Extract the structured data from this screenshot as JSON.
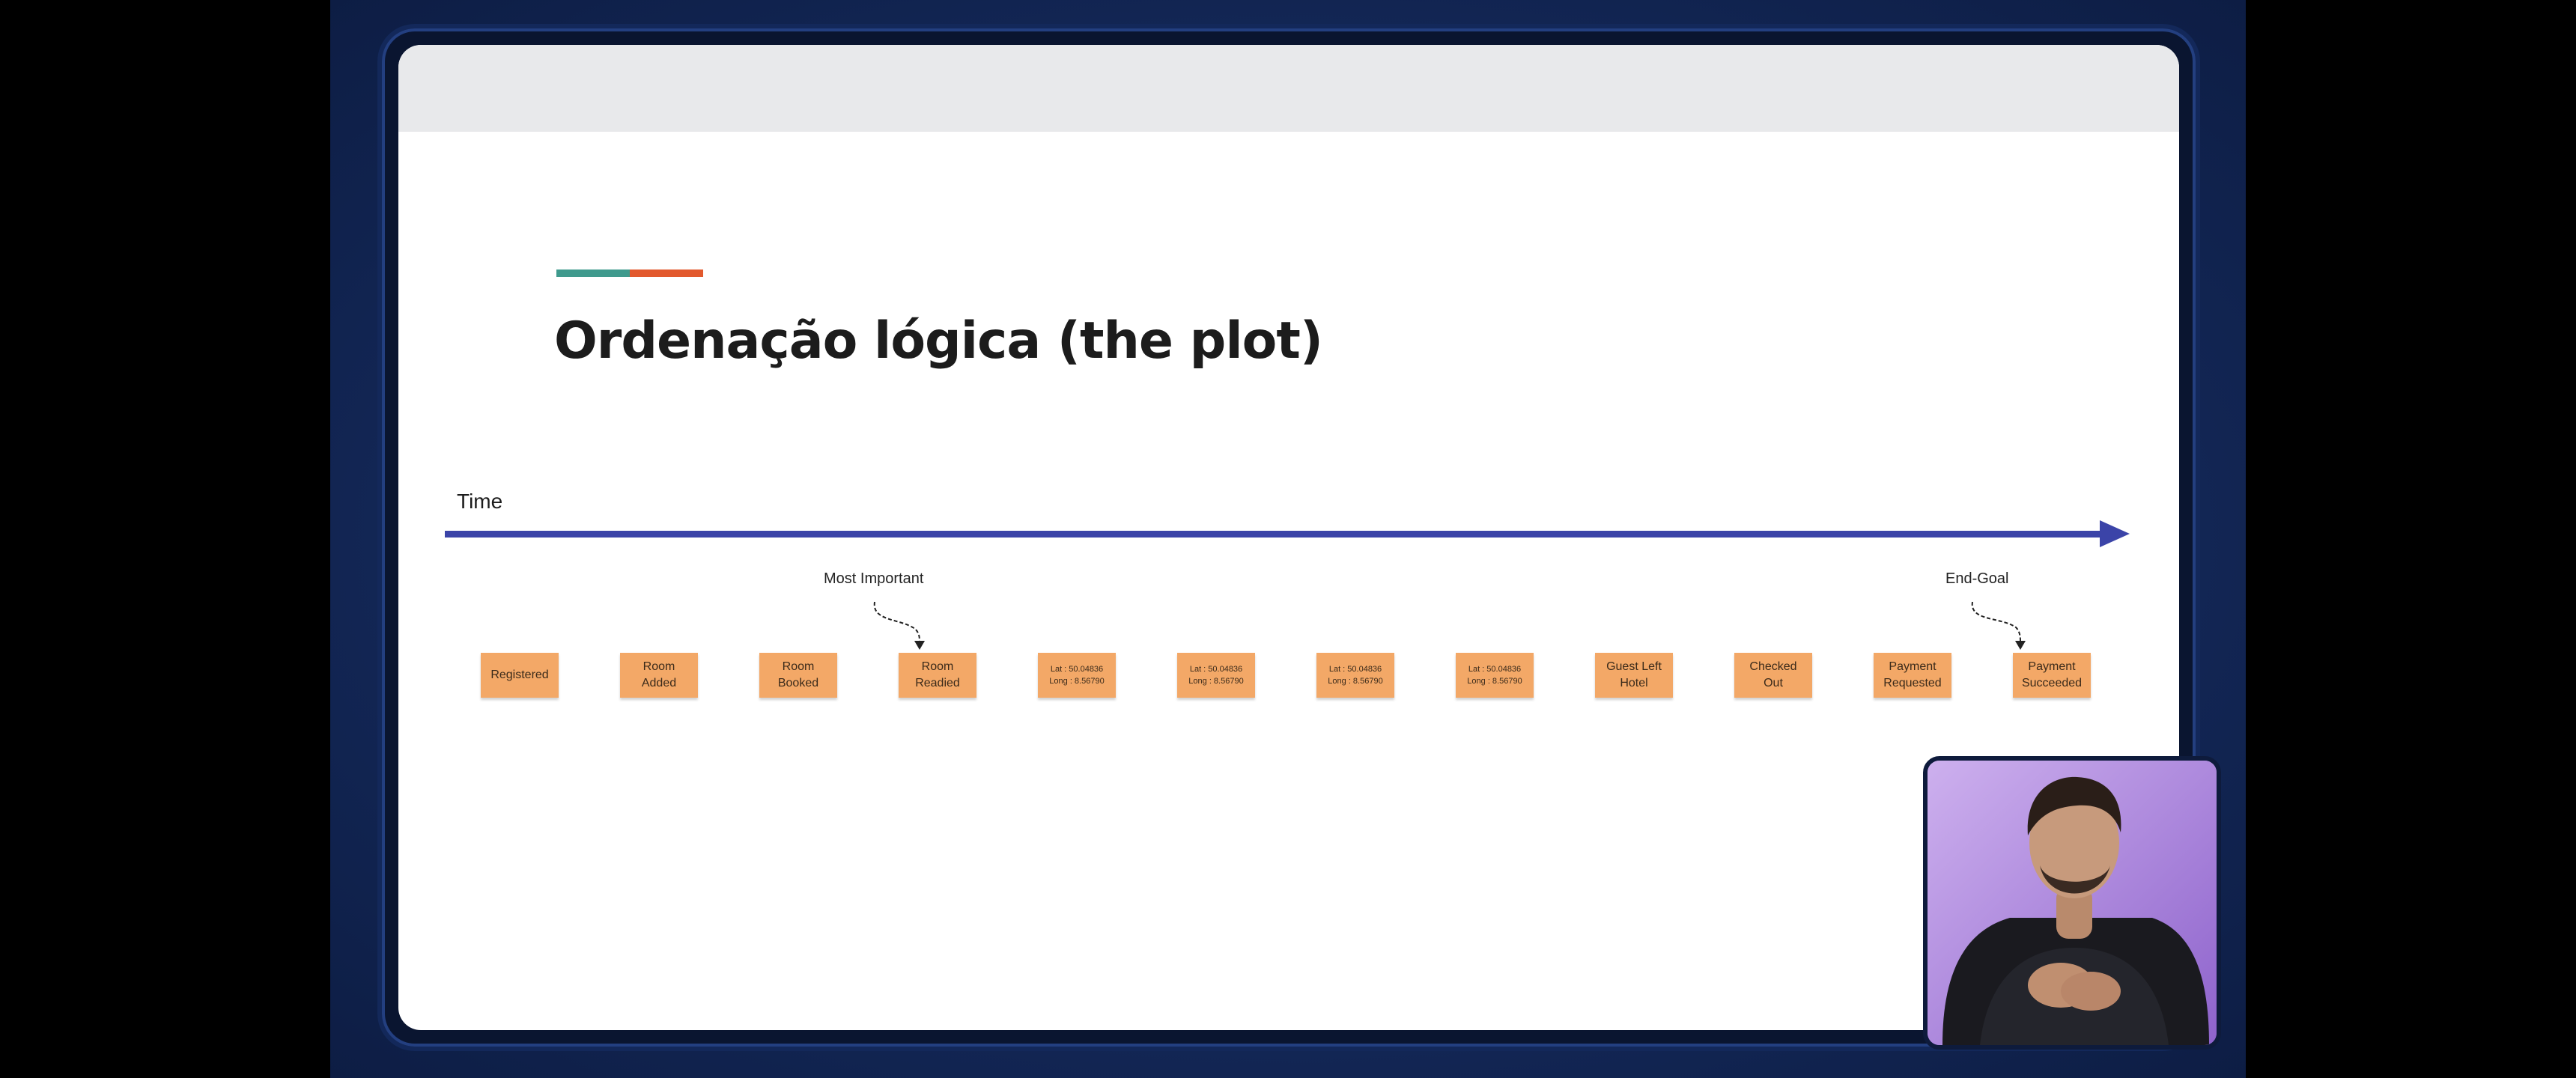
{
  "slide": {
    "title": "Ordenação lógica (the plot)",
    "accent_colors": [
      "#3f9a8d",
      "#e2592d"
    ],
    "timeline": {
      "label": "Time",
      "color": "#3b44a8"
    },
    "annotations": {
      "most_important": "Most Important",
      "end_goal": "End-Goal"
    },
    "events": [
      {
        "label": "Registered",
        "small": false
      },
      {
        "label": "Room\nAdded",
        "small": false
      },
      {
        "label": "Room\nBooked",
        "small": false
      },
      {
        "label": "Room\nReadied",
        "small": false
      },
      {
        "label": "Lat : 50.04836\nLong : 8.56790",
        "small": true
      },
      {
        "label": "Lat : 50.04836\nLong : 8.56790",
        "small": true
      },
      {
        "label": "Lat : 50.04836\nLong : 8.56790",
        "small": true
      },
      {
        "label": "Lat : 50.04836\nLong : 8.56790",
        "small": true
      },
      {
        "label": "Guest Left\nHotel",
        "small": false
      },
      {
        "label": "Checked\nOut",
        "small": false
      },
      {
        "label": "Payment\nRequested",
        "small": false
      },
      {
        "label": "Payment\nSucceeded",
        "small": false
      }
    ],
    "note_color": "#f3a867"
  },
  "webcam": {
    "icon": "presenter-video"
  }
}
